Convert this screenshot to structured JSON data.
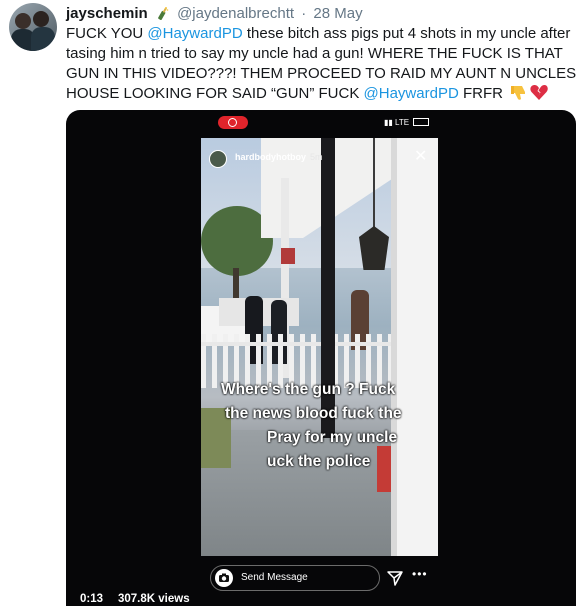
{
  "tweet": {
    "display_name": "jayschemin",
    "handle": "@jaydenalbrechtt",
    "separator": "·",
    "date": "28 May",
    "text": {
      "part1": "FUCK YOU ",
      "mention1": "@HaywardPD",
      "part2": " these bitch ass pigs put 4 shots in my uncle after tasing him n tried to say my uncle had a gun! WHERE THE FUCK IS THAT GUN IN THIS VIDEO???! THEM PROCEED TO RAID MY AUNT N UNCLES HOUSE LOOKING FOR SAID “GUN” FUCK ",
      "mention2": "@HaywardPD",
      "part3": " FRFR"
    },
    "colors": {
      "mention": "#1b95e0",
      "text": "#14171a",
      "muted": "#657786"
    }
  },
  "video": {
    "status_bar": {
      "carrier": "LTE"
    },
    "story": {
      "username": "hardbodyhotboy",
      "time": "5m",
      "caption_lines": [
        "Where's the gun ? Fuck",
        "the news blood fuck the",
        "Pray for my uncle",
        "uck the police"
      ],
      "message_placeholder": "Send Message"
    },
    "timecode": "0:13",
    "views": "307.8K views"
  },
  "icons": {
    "bottle": "champagne-bottle-icon",
    "thumbs_down": "thumbs-down-icon",
    "broken_heart": "broken-heart-icon",
    "camera": "camera-icon",
    "send": "send-icon",
    "more": "more-icon",
    "close": "close-icon"
  }
}
